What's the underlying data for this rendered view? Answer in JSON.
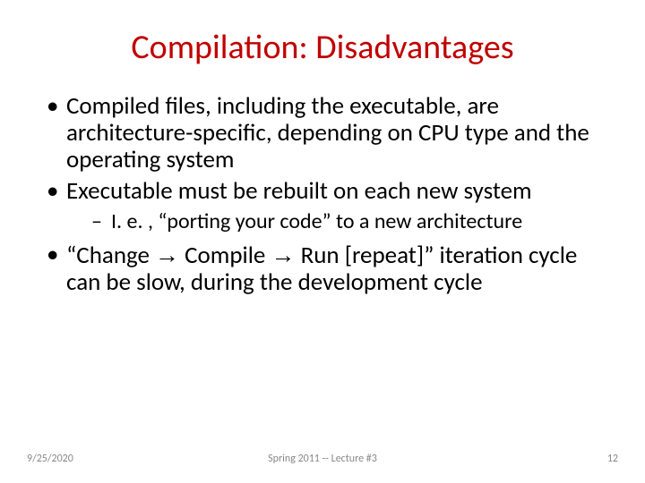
{
  "title": "Compilation: Disadvantages",
  "bullets": {
    "b1": "Compiled files, including the executable, are architecture-specific, depending on CPU type and the operating system",
    "b2": "Executable must be rebuilt on each new system",
    "b2_sub": "I. e. , “porting your code” to a new architecture",
    "b3_pre": "“Change ",
    "b3_mid1": " Compile ",
    "b3_mid2": " Run [repeat]” iteration cycle can be slow, during the development cycle",
    "arrow": "→"
  },
  "footer": {
    "date": "9/25/2020",
    "center": "Spring 2011 -- Lecture #3",
    "page": "12"
  }
}
